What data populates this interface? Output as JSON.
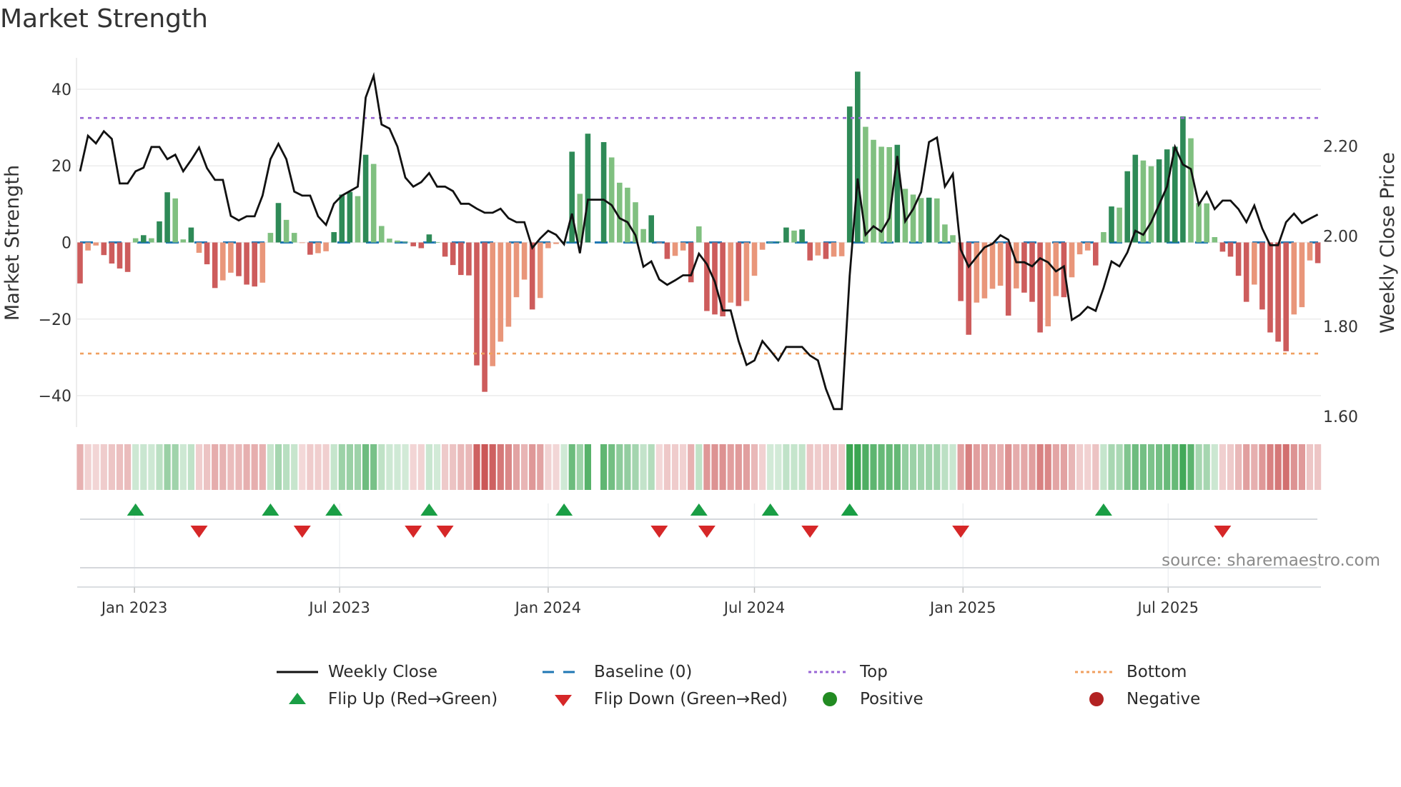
{
  "title": "Market Strength",
  "chart_data": {
    "type": "bar",
    "title": "Market Strength",
    "ylabel": "Market Strength",
    "ylabel_right": "Weekly Close Price",
    "ylim": [
      -48.2,
      48.2
    ],
    "ylim_right": [
      1.576,
      2.396
    ],
    "y_ticks": [
      {
        "value": 40,
        "label": "40"
      },
      {
        "value": 20,
        "label": "20"
      },
      {
        "value": 0,
        "label": "0"
      },
      {
        "value": -20,
        "label": "−20"
      },
      {
        "value": -40,
        "label": "−40"
      }
    ],
    "y_ticks_right": [
      {
        "value": 2.2,
        "label": "2.20"
      },
      {
        "value": 2.0,
        "label": "2.00"
      },
      {
        "value": 1.8,
        "label": "1.80"
      },
      {
        "value": 1.6,
        "label": "1.60"
      }
    ],
    "x_ticks": [
      {
        "date": "2023-01-01",
        "label": "Jan 2023"
      },
      {
        "date": "2023-07-01",
        "label": "Jul 2023"
      },
      {
        "date": "2024-01-01",
        "label": "Jan 2024"
      },
      {
        "date": "2024-07-01",
        "label": "Jul 2024"
      },
      {
        "date": "2025-01-01",
        "label": "Jan 2025"
      },
      {
        "date": "2025-07-01",
        "label": "Jul 2025"
      }
    ],
    "start_week": "2022-11-14",
    "grid": true,
    "top_level": 32.5,
    "bottom_level": -29,
    "baseline": 0,
    "strength": [
      -10.7,
      -2.1,
      -0.8,
      -3.3,
      -5.5,
      -6.8,
      -7.7,
      1.1,
      1.9,
      1.1,
      5.5,
      13.1,
      11.5,
      0.8,
      3.9,
      -2.7,
      -5.7,
      -11.9,
      -9.9,
      -7.9,
      -8.8,
      -11,
      -11.5,
      -10.5,
      2.5,
      10.3,
      5.9,
      2.5,
      -0.1,
      -3.2,
      -2.8,
      -2.3,
      2.7,
      12.5,
      13.2,
      12.1,
      22.9,
      20.5,
      4.3,
      1,
      0.5,
      0.2,
      -1,
      -1.5,
      2.1,
      0.1,
      -3.7,
      -5.9,
      -8.5,
      -8.6,
      -32.1,
      -39,
      -32.3,
      -25.9,
      -22,
      -14.3,
      -9.7,
      -17.5,
      -14.5,
      -1.5,
      -0.4,
      0.3,
      23.7,
      12.7,
      28.4,
      0,
      26.2,
      22.2,
      15.6,
      14.3,
      10.5,
      3.5,
      7.1,
      -0.2,
      -4.3,
      -3.5,
      -2.1,
      -10.4,
      4.2,
      -17.9,
      -18.8,
      -19.3,
      -15.7,
      -16.6,
      -15.3,
      -8.7,
      -1.9,
      0.1,
      0.2,
      3.9,
      3.1,
      3.4,
      -4.7,
      -3.4,
      -4.3,
      -3.7,
      -3.6,
      35.5,
      44.6,
      30.2,
      26.8,
      25,
      24.9,
      25.5,
      14,
      12.5,
      11.6,
      11.7,
      11.5,
      4.7,
      1.9,
      -15.3,
      -24.1,
      -15.7,
      -14.6,
      -12.1,
      -11.3,
      -19.1,
      -12,
      -13.1,
      -15.5,
      -23.5,
      -21.9,
      -14,
      -14.3,
      -9.1,
      -3.1,
      -2.1,
      -6,
      2.7,
      9.4,
      9.1,
      18.6,
      22.9,
      21.4,
      19.9,
      21.7,
      24.3,
      25,
      32.9,
      27.2,
      10.3,
      10.2,
      1.4,
      -2.4,
      -3.7,
      -8.7,
      -15.5,
      -11,
      -17.5,
      -23.5,
      -25.9,
      -28.4,
      -18.8,
      -16.9,
      -4.7,
      -5.4
    ],
    "weekly_close": [
      2.144,
      2.223,
      2.206,
      2.233,
      2.216,
      2.117,
      2.117,
      2.144,
      2.152,
      2.198,
      2.198,
      2.171,
      2.181,
      2.144,
      2.169,
      2.197,
      2.151,
      2.125,
      2.125,
      2.045,
      2.035,
      2.044,
      2.044,
      2.09,
      2.171,
      2.205,
      2.171,
      2.099,
      2.09,
      2.09,
      2.044,
      2.025,
      2.072,
      2.09,
      2.1,
      2.11,
      2.308,
      2.356,
      2.248,
      2.239,
      2.199,
      2.13,
      2.11,
      2.12,
      2.14,
      2.11,
      2.11,
      2.1,
      2.072,
      2.072,
      2.061,
      2.052,
      2.052,
      2.061,
      2.04,
      2.031,
      2.031,
      1.974,
      1.995,
      2.012,
      2.003,
      1.982,
      2.05,
      1.962,
      2.081,
      2.081,
      2.081,
      2.069,
      2.04,
      2.031,
      2.002,
      1.932,
      1.944,
      1.904,
      1.892,
      1.902,
      1.913,
      1.913,
      1.961,
      1.938,
      1.899,
      1.835,
      1.835,
      1.767,
      1.714,
      1.724,
      1.767,
      1.746,
      1.724,
      1.754,
      1.754,
      1.754,
      1.735,
      1.724,
      1.661,
      1.616,
      1.616,
      1.912,
      2.128,
      2.003,
      2.022,
      2.01,
      2.04,
      2.178,
      2.033,
      2.06,
      2.098,
      2.209,
      2.219,
      2.11,
      2.138,
      1.97,
      1.932,
      1.954,
      1.975,
      1.983,
      2.002,
      1.992,
      1.942,
      1.942,
      1.933,
      1.951,
      1.942,
      1.922,
      1.933,
      1.814,
      1.825,
      1.843,
      1.834,
      1.885,
      1.944,
      1.933,
      1.964,
      2.012,
      2.003,
      2.031,
      2.07,
      2.11,
      2.198,
      2.159,
      2.149,
      2.07,
      2.098,
      2.06,
      2.079,
      2.079,
      2.06,
      2.031,
      2.068,
      2.017,
      1.98,
      1.98,
      2.031,
      2.05,
      2.029,
      2.039,
      2.048
    ],
    "flip_up": [
      "2023-01-02",
      "2023-05-01",
      "2023-06-26",
      "2023-09-18",
      "2024-01-15",
      "2024-05-13",
      "2024-07-15",
      "2024-09-23",
      "2025-05-05"
    ],
    "flip_down": [
      "2023-02-27",
      "2023-05-29",
      "2023-09-04",
      "2023-10-02",
      "2024-04-08",
      "2024-05-20",
      "2024-08-19",
      "2024-12-30",
      "2025-08-18"
    ],
    "colors": {
      "pos_rising": "#2e8a57",
      "pos_falling": "#80c080",
      "neg_rising": "#cd5c5c",
      "neg_falling": "#e9967a",
      "baseline": "#1f77b4",
      "top": "#9966d6",
      "bottom": "#f0a060",
      "close": "#111111",
      "flip_up": "#1a9e45",
      "flip_down": "#d62728",
      "positive": "#228b22",
      "negative": "#b22222"
    },
    "legend": [
      {
        "label": "Weekly Close",
        "symbol": "line"
      },
      {
        "label": "Baseline (0)",
        "symbol": "dash"
      },
      {
        "label": "Top",
        "symbol": "dot-purple"
      },
      {
        "label": "Bottom",
        "symbol": "dot-orange"
      },
      {
        "label": "Flip Up (Red→Green)",
        "symbol": "triangle-up"
      },
      {
        "label": "Flip Down (Green→Red)",
        "symbol": "triangle-down"
      },
      {
        "label": "Positive",
        "symbol": "circle-green"
      },
      {
        "label": "Negative",
        "symbol": "circle-red"
      }
    ],
    "legend_position": "bottom",
    "source": "source: sharemaestro.com"
  }
}
